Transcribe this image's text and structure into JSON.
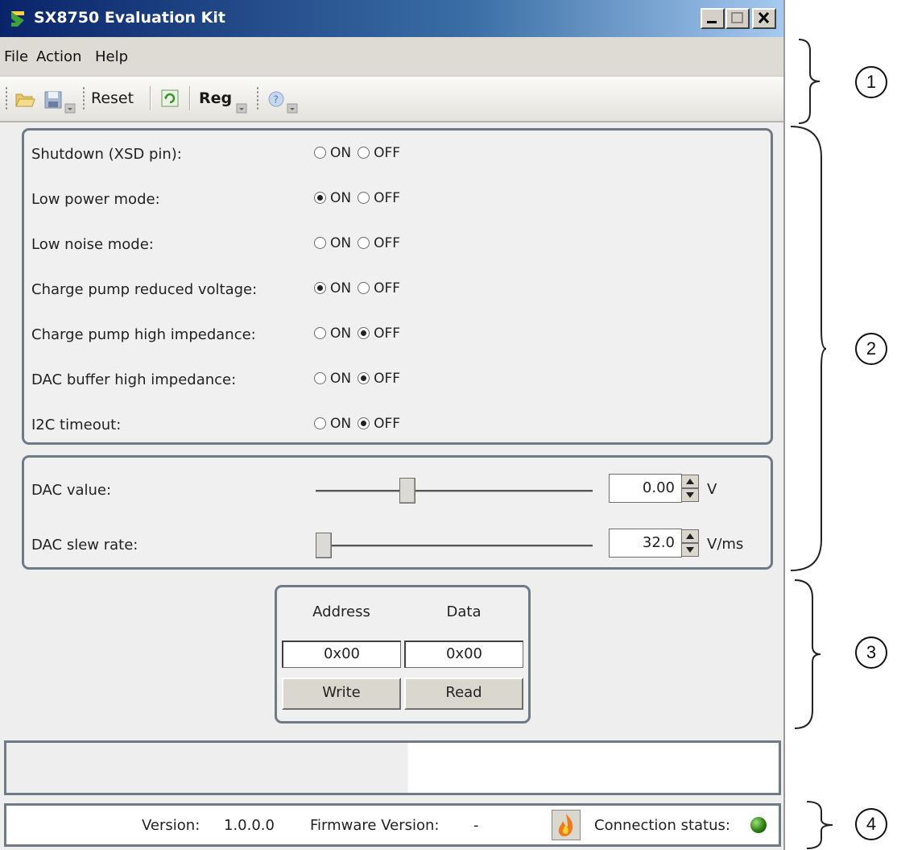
{
  "window": {
    "title": "SX8750 Evaluation Kit"
  },
  "menu": {
    "items": [
      "File",
      "Action",
      "Help"
    ]
  },
  "toolbar": {
    "reset_label": "Reset",
    "reg_label": "Reg"
  },
  "settings": {
    "on_label": "ON",
    "off_label": "OFF",
    "rows": [
      {
        "label": "Shutdown (XSD pin):",
        "selected": "none"
      },
      {
        "label": "Low power mode:",
        "selected": "on"
      },
      {
        "label": "Low noise mode:",
        "selected": "none"
      },
      {
        "label": "Charge pump reduced voltage:",
        "selected": "on"
      },
      {
        "label": "Charge pump high impedance:",
        "selected": "off"
      },
      {
        "label": "DAC buffer high impedance:",
        "selected": "off"
      },
      {
        "label": "I2C timeout:",
        "selected": "off"
      }
    ]
  },
  "dac": {
    "value_label": "DAC value:",
    "value": "0.00",
    "value_unit": "V",
    "value_slider_fraction": 0.32,
    "slew_label": "DAC slew rate:",
    "slew": "32.0",
    "slew_unit": "V/ms",
    "slew_slider_fraction": 0.0
  },
  "register": {
    "address_header": "Address",
    "data_header": "Data",
    "address_value": "0x00",
    "data_value": "0x00",
    "write_label": "Write",
    "read_label": "Read"
  },
  "status": {
    "version_label": "Version:",
    "version_value": "1.0.0.0",
    "firmware_label": "Firmware Version:",
    "firmware_value": "-",
    "connection_label": "Connection status:",
    "connection_color": "#2e7d12"
  },
  "callouts": [
    "1",
    "2",
    "3",
    "4"
  ]
}
